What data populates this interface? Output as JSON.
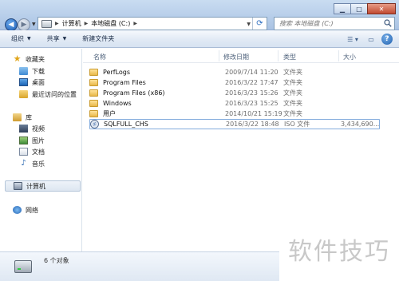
{
  "address": {
    "crumbs": [
      "计算机",
      "本地磁盘 (C:)"
    ]
  },
  "search": {
    "placeholder": "搜索 本地磁盘 (C:)"
  },
  "toolbar": {
    "organize": "组织",
    "share": "共享",
    "new_folder": "新建文件夹"
  },
  "nav": {
    "favorites": "收藏夹",
    "downloads": "下载",
    "desktop": "桌面",
    "recent": "最近访问的位置",
    "libraries": "库",
    "videos": "视频",
    "pictures": "图片",
    "documents": "文档",
    "music": "音乐",
    "computer": "计算机",
    "network": "网络"
  },
  "columns": {
    "name": "名称",
    "date": "修改日期",
    "type": "类型",
    "size": "大小"
  },
  "files": [
    {
      "name": "PerfLogs",
      "date": "2009/7/14 11:20",
      "type": "文件夹",
      "size": ""
    },
    {
      "name": "Program Files",
      "date": "2016/3/22 17:47",
      "type": "文件夹",
      "size": ""
    },
    {
      "name": "Program Files (x86)",
      "date": "2016/3/23 15:26",
      "type": "文件夹",
      "size": ""
    },
    {
      "name": "Windows",
      "date": "2016/3/23 15:25",
      "type": "文件夹",
      "size": ""
    },
    {
      "name": "用户",
      "date": "2014/10/21 15:19",
      "type": "文件夹",
      "size": ""
    },
    {
      "name": "SQLFULL_CHS",
      "date": "2016/3/22 18:48",
      "type": "ISO 文件",
      "size": "3,434,690..."
    }
  ],
  "status": {
    "count": "6 个对象"
  },
  "watermark": "软件技巧"
}
